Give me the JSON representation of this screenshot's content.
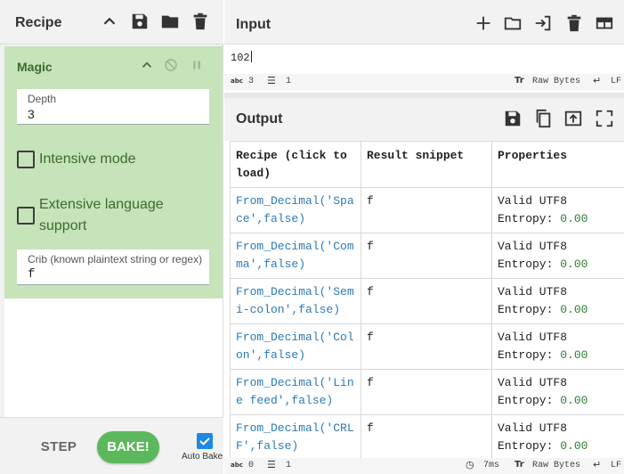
{
  "recipe": {
    "title": "Recipe",
    "operation": {
      "name": "Magic",
      "depth_label": "Depth",
      "depth_value": "3",
      "intensive_label": "Intensive mode",
      "intensive_checked": false,
      "extensive_label": "Extensive language support",
      "extensive_checked": false,
      "crib_label": "Crib (known plaintext string or regex)",
      "crib_value": "f"
    },
    "step_label": "STEP",
    "bake_label": "BAKE!",
    "autobake_label": "Auto Bake",
    "autobake_checked": true
  },
  "input": {
    "title": "Input",
    "text": "102",
    "status": {
      "length_icon": "abc",
      "length": "3",
      "lines": "1",
      "encoding_icon": "Tr",
      "encoding": "Raw Bytes",
      "eol": "LF"
    }
  },
  "output": {
    "title": "Output",
    "table": {
      "headers": [
        "Recipe (click to load)",
        "Result snippet",
        "Properties"
      ],
      "rows": [
        {
          "recipe": "From_Decimal('Space',false)",
          "snippet": "f",
          "valid": "Valid UTF8",
          "entropy_label": "Entropy:",
          "entropy": "0.00"
        },
        {
          "recipe": "From_Decimal('Comma',false)",
          "snippet": "f",
          "valid": "Valid UTF8",
          "entropy_label": "Entropy:",
          "entropy": "0.00"
        },
        {
          "recipe": "From_Decimal('Semi-colon',false)",
          "snippet": "f",
          "valid": "Valid UTF8",
          "entropy_label": "Entropy:",
          "entropy": "0.00"
        },
        {
          "recipe": "From_Decimal('Colon',false)",
          "snippet": "f",
          "valid": "Valid UTF8",
          "entropy_label": "Entropy:",
          "entropy": "0.00"
        },
        {
          "recipe": "From_Decimal('Line feed',false)",
          "snippet": "f",
          "valid": "Valid UTF8",
          "entropy_label": "Entropy:",
          "entropy": "0.00"
        },
        {
          "recipe": "From_Decimal('CRLF',false)",
          "snippet": "f",
          "valid": "Valid UTF8",
          "entropy_label": "Entropy:",
          "entropy": "0.00"
        }
      ]
    },
    "status": {
      "length_icon": "abc",
      "length": "0",
      "lines": "1",
      "time": "7ms",
      "encoding_icon": "Tr",
      "encoding": "Raw Bytes",
      "eol": "LF"
    }
  },
  "colors": {
    "operation_bg": "#c7e3b9",
    "bake_button": "#5cb85c",
    "link": "#2a7ab8",
    "entropy_value": "#2e7d32",
    "autobake_checkbox": "#1e88e5"
  },
  "icons": {
    "recipe_header": [
      "chevron-up-icon",
      "save-icon",
      "folder-icon",
      "trash-icon"
    ],
    "operation": [
      "chevron-up-icon",
      "disable-icon",
      "pause-icon"
    ],
    "input_header": [
      "plus-icon",
      "folder-icon",
      "input-file-icon",
      "trash-icon",
      "layout-icon"
    ],
    "output_header": [
      "save-icon",
      "copy-icon",
      "replace-input-icon",
      "maximize-icon"
    ]
  }
}
